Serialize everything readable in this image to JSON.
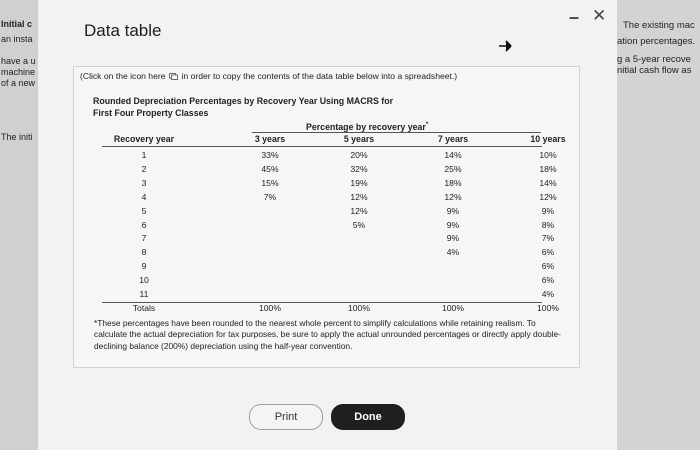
{
  "background_left": {
    "lines": [
      {
        "text": "Initial c",
        "bold": true
      },
      {
        "text": "an insta",
        "bold": false
      },
      {
        "text": "have a u",
        "bold": false
      },
      {
        "text": "machine",
        "bold": false
      },
      {
        "text": "of a new",
        "bold": false
      },
      {
        "text": "The initi",
        "bold": false
      }
    ]
  },
  "background_right": {
    "lines": [
      "The existing mac",
      "ation percentages.",
      "g a 5-year recove",
      "nitial cash flow as"
    ]
  },
  "dialog": {
    "title": "Data table",
    "minimize_glyph": "–",
    "close_glyph": "✕"
  },
  "panel": {
    "copy_text_before": "(Click on the icon here",
    "copy_text_after": "in order to copy the contents of the data table below into a spreadsheet.)",
    "table_title_line1": "Rounded Depreciation Percentages by Recovery Year Using MACRS for",
    "table_title_line2": "First Four Property Classes",
    "group_header": "Percentage by recovery year",
    "group_header_mark": "*",
    "columns": [
      "Recovery year",
      "3 years",
      "5 years",
      "7 years",
      "10 years"
    ],
    "rows": [
      [
        "1",
        "33%",
        "20%",
        "14%",
        "10%"
      ],
      [
        "2",
        "45%",
        "32%",
        "25%",
        "18%"
      ],
      [
        "3",
        "15%",
        "19%",
        "18%",
        "14%"
      ],
      [
        "4",
        "7%",
        "12%",
        "12%",
        "12%"
      ],
      [
        "5",
        "",
        "12%",
        "9%",
        "9%"
      ],
      [
        "6",
        "",
        "5%",
        "9%",
        "8%"
      ],
      [
        "7",
        "",
        "",
        "9%",
        "7%"
      ],
      [
        "8",
        "",
        "",
        "4%",
        "6%"
      ],
      [
        "9",
        "",
        "",
        "",
        "6%"
      ],
      [
        "10",
        "",
        "",
        "",
        "6%"
      ],
      [
        "11",
        "",
        "",
        "",
        "4%"
      ],
      [
        "Totals",
        "100%",
        "100%",
        "100%",
        "100%"
      ]
    ],
    "footnote": "*These percentages have been rounded to the nearest whole percent to simplify calculations while retaining realism. To calculate the actual depreciation for tax purposes, be sure to apply the actual unrounded percentages or directly apply double-declining balance (200%) depreciation using the half-year convention."
  },
  "buttons": {
    "print": "Print",
    "done": "Done"
  },
  "icons": [
    "copy-icon",
    "minimize-icon",
    "close-icon",
    "cursor-icon"
  ]
}
